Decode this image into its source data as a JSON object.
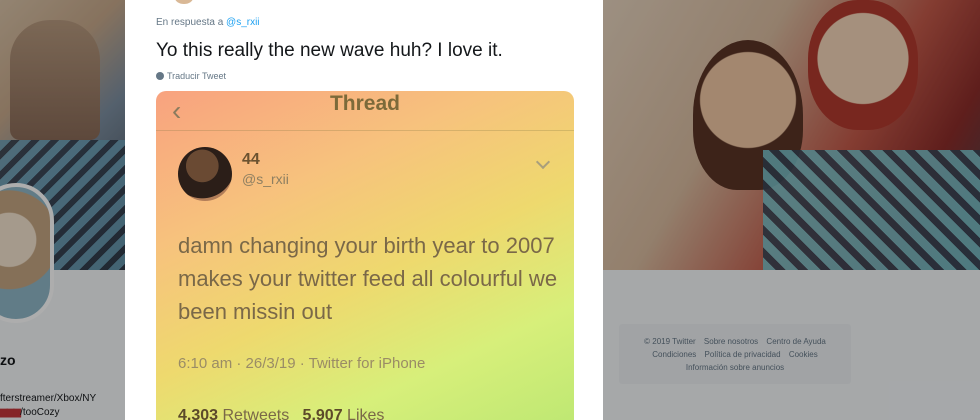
{
  "reply": {
    "prefix": "En respuesta a",
    "handle": "@s_rxii"
  },
  "tweet": {
    "text": "Yo this really the new wave huh? I love it.",
    "translate_label": "Traducir Tweet"
  },
  "screenshot": {
    "header_title": "Thread",
    "author_name": "44",
    "author_handle": "@s_rxii",
    "body": "damn changing your birth year to 2007 makes your twitter feed all colourful we been missin out",
    "meta": "6:10 am · 26/3/19 · Twitter for iPhone",
    "retweets_count": "4,303",
    "retweets_label": "Retweets",
    "likes_count": "5,907",
    "likes_label": "Likes"
  },
  "background_profile": {
    "name_fragment": "zo",
    "bio_line1": "fterstreamer/Xbox/NY",
    "bio_line2_flags": "▆▆▆",
    "bio_line2_text": "/tooCozy"
  },
  "footer": {
    "links": [
      "© 2019 Twitter",
      "Sobre nosotros",
      "Centro de Ayuda",
      "Condiciones",
      "Política de privacidad",
      "Cookies",
      "Información sobre anuncios"
    ]
  },
  "colors": {
    "link_blue": "#1da1f2",
    "muted_text": "#657786",
    "gradient_start": "#f8a27f",
    "gradient_end": "#bfe873"
  }
}
